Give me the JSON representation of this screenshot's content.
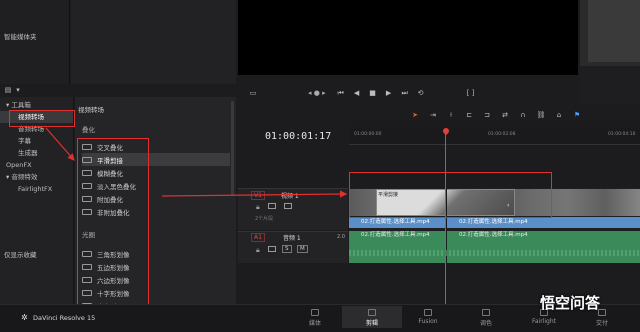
{
  "media_pool": {
    "label": "智能媒体夹"
  },
  "effects_tree": {
    "items": [
      {
        "label": "工具箱",
        "indent": 0,
        "arrow": true
      },
      {
        "label": "视频转场",
        "indent": 1,
        "selected": true
      },
      {
        "label": "音频转场",
        "indent": 1
      },
      {
        "label": "字幕",
        "indent": 1
      },
      {
        "label": "生成器",
        "indent": 1
      },
      {
        "label": "OpenFX",
        "indent": 0
      },
      {
        "label": "音频特效",
        "indent": 0,
        "arrow": true
      },
      {
        "label": "FairlightFX",
        "indent": 1
      }
    ],
    "favorites_label": "仅显示收藏"
  },
  "transitions": {
    "header": "视频转场",
    "group1": "叠化",
    "items1": [
      "交叉叠化",
      "平滑剪接",
      "模糊叠化",
      "淡入黑色叠化",
      "附加叠化",
      "非附加叠化"
    ],
    "group2": "光圈",
    "items2": [
      "三角形划像",
      "五边形划像",
      "六边形划像",
      "十字形划像",
      "十字形开"
    ],
    "hover_index": 1
  },
  "viewer": {
    "timecode_small": "◂ ● ▸"
  },
  "timeline": {
    "timecode": "01:00:01:17",
    "ruler": [
      "01:00:00:00",
      "01:00:02:08",
      "01:00:04:16"
    ],
    "v1": {
      "tag": "V1",
      "name": "视频 1",
      "clips": "2个片段"
    },
    "a1": {
      "tag": "A1",
      "name": "音频 1",
      "level": "2.0"
    },
    "transition_label": "平滑剪接",
    "video_clips": [
      "02.打造属性.选择工具.mp4",
      "02.打造属性.选择工具.mp4"
    ],
    "audio_clips": [
      "02.打造属性.选择工具.mp4",
      "02.打造属性.选择工具.mp4"
    ],
    "audio_buttons": [
      "S",
      "M"
    ]
  },
  "bottom_bar": {
    "app": "DaVinci Resolve 15",
    "tabs": [
      "媒体",
      "剪辑",
      "Fusion",
      "调色",
      "Fairlight",
      "交付"
    ],
    "active": 1,
    "watermark": "悟空问答"
  },
  "colors": {
    "accent": "#e03030",
    "video": "#5b8fc7",
    "audio": "#3a8a5a",
    "playhead": "#e04040"
  }
}
